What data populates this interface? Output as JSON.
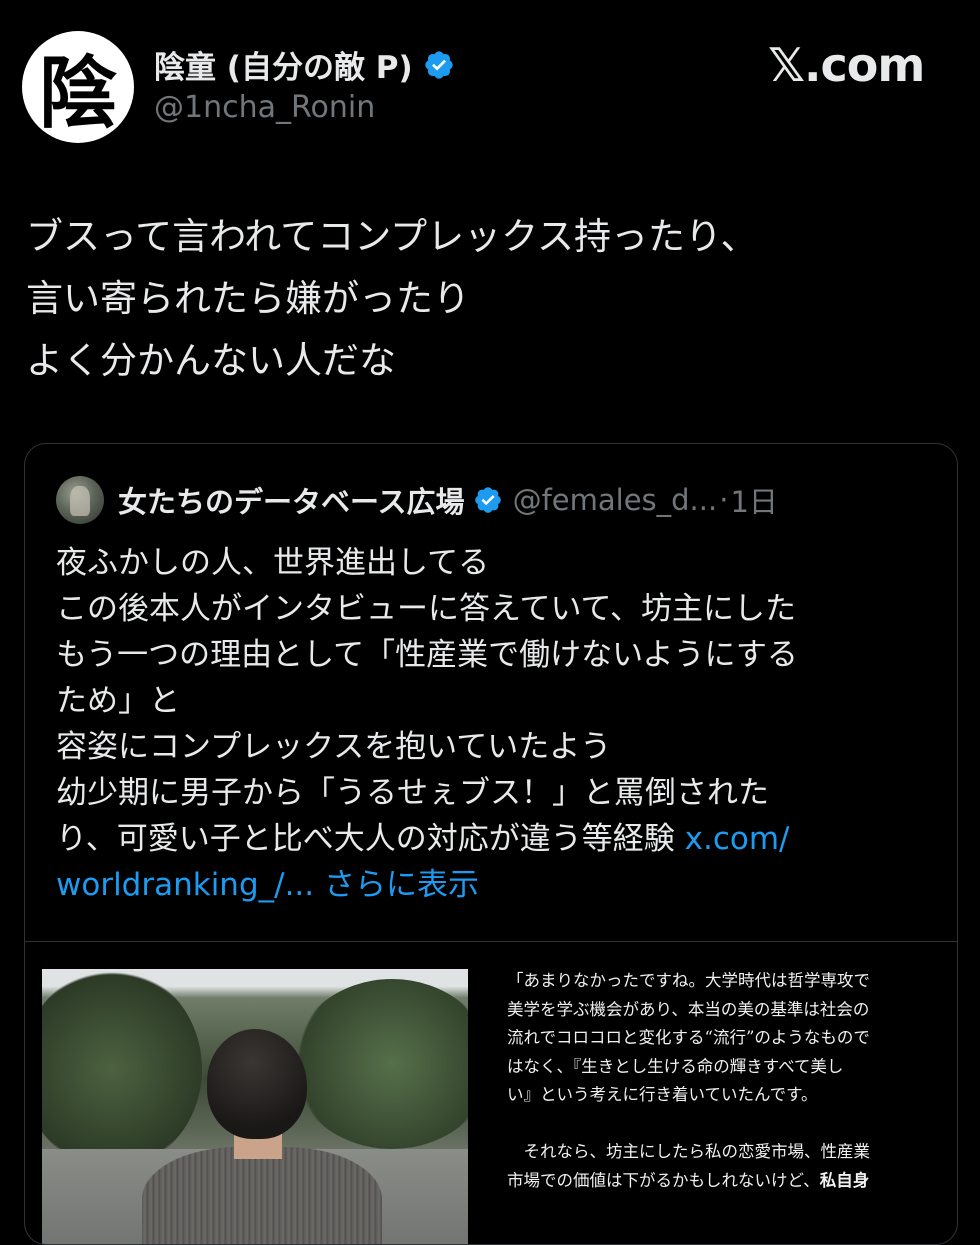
{
  "author": {
    "avatar_glyph": "陰",
    "display_name": "陰童 (自分の敵 P)",
    "handle": "@1ncha_Ronin",
    "verified": true
  },
  "brand": "𝕏.com",
  "tweet_lines": [
    "ブスって言われてコンプレックス持ったり、",
    "言い寄られたら嫌がったり",
    "よく分かんない人だな"
  ],
  "quote": {
    "name": "女たちのデータベース広場",
    "handle": "@females_d...",
    "dot": "·",
    "time": "1日",
    "lines": [
      "夜ふかしの人、世界進出してる",
      "この後本人がインタビューに答えていて、坊主にした",
      "もう一つの理由として「性産業で働けないようにする",
      "ため」と",
      "容姿にコンプレックスを抱いていたよう",
      "幼少期に男子から「うるせぇブス！」と罵倒された",
      "り、可愛い子と比べ大人の対応が違う等経験 "
    ],
    "link_inline": "x.com/",
    "link_line": "worldranking_/...",
    "show_more": "さらに表示",
    "article_lines": [
      "「あまりなかったですね。大学時代は哲学専攻で",
      "美学を学ぶ機会があり、本当の美の基準は社会の",
      "流れでコロコロと変化する“流行”のようなもので",
      "はなく、『生きとし生ける命の輝きすべて美し",
      "い』という考えに行き着いていたんです。",
      "",
      "　それなら、坊主にしたら私の恋愛市場、性産業",
      "市場での価値は下がるかもしれないけど、"
    ],
    "article_bold_tail": "私自身"
  },
  "colors": {
    "background": "#000000",
    "text": "#e7e9ea",
    "muted": "#71767b",
    "link": "#1d9bf0",
    "verified": "#1d9bf0"
  }
}
